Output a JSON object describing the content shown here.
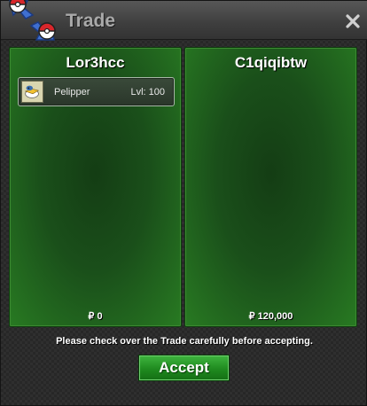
{
  "window": {
    "title": "Trade",
    "close_symbol": "×"
  },
  "trade": {
    "left": {
      "player": "Lor3hcc",
      "pokemon": [
        {
          "name": "Pelipper",
          "level": "Lvl: 100",
          "icon": "pelipper-icon"
        }
      ],
      "money": "₽ 0"
    },
    "right": {
      "player": "C1qiqibtw",
      "pokemon": [],
      "money": "₽ 120,000"
    }
  },
  "notice": "Please check over the Trade carefully before accepting.",
  "accept_label": "Accept",
  "colors": {
    "panel_green": "#1a4f1a",
    "button_green": "#1f8a1f",
    "title_text": "#a9a9a9"
  }
}
